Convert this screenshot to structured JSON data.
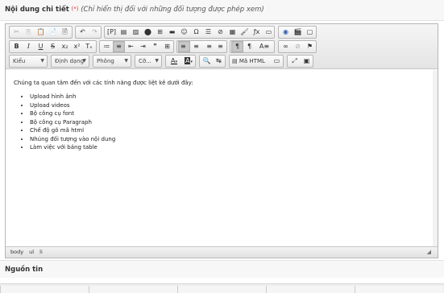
{
  "header": {
    "title": "Nội dung chi tiết",
    "required_mark": "(*)",
    "note": "(Chỉ hiển thị đối với những đối tượng được phép xem)"
  },
  "toolbar": {
    "row1": {
      "clipboard": [
        "cut-icon",
        "copy-icon",
        "paste-icon",
        "paste-text-icon",
        "paste-word-icon"
      ],
      "history": [
        "undo-icon",
        "redo-icon"
      ],
      "insert": [
        "template-icon",
        "page-icon",
        "image-icon",
        "flash-icon",
        "table-icon",
        "horizontal-rule-icon",
        "smiley-icon",
        "special-char-icon",
        "iframe-icon",
        "link-icon",
        "anchor-icon",
        "highlight-icon",
        "formula-icon",
        "preview-icon"
      ],
      "extra": [
        "about-icon",
        "video-icon",
        "maximize-small-icon"
      ]
    },
    "row2": {
      "basic": [
        {
          "label": "B",
          "name": "bold"
        },
        {
          "label": "I",
          "name": "italic"
        },
        {
          "label": "U",
          "name": "underline"
        },
        {
          "label": "S",
          "name": "strike"
        },
        {
          "label": "x₂",
          "name": "subscript"
        },
        {
          "label": "x²",
          "name": "superscript"
        },
        {
          "label": "Tₓ",
          "name": "remove-format"
        }
      ],
      "list_glyphs": [
        "≔",
        "≡",
        "⇤",
        "⇥",
        "❞",
        "⊞"
      ],
      "align_glyphs": [
        "≡",
        "≡",
        "≡",
        "≡"
      ],
      "bidi_glyphs": [
        "¶",
        "¶",
        "A≡"
      ],
      "link_glyphs": [
        "∞",
        "⊘",
        "⚑"
      ]
    },
    "row3": {
      "style": "Kiểu",
      "format": "Định dạng",
      "font": "Phông",
      "size": "Cỡ...",
      "text_color": "A",
      "bg_color": "A",
      "find_glyph": "🔍",
      "replace_glyph": "↹",
      "source_label": "Mã HTML",
      "maximize_glyph": "⤢",
      "show_blocks_glyph": "▣"
    }
  },
  "content": {
    "intro": "Chúng ta quan tâm đến với các tính năng được liệt kê dưới đây:",
    "items": [
      "Upload hình ảnh",
      "Upload videos",
      "Bộ công cụ font",
      "Bộ công cụ Paragraph",
      "Chế độ gõ mã html",
      "Nhúng đối tượng vào nội dung",
      "Làm việc với bảng table"
    ]
  },
  "status": {
    "path": [
      "body",
      "ul",
      "li"
    ],
    "resize_glyph": "◢"
  },
  "source": {
    "title": "Nguồn tin"
  },
  "colors": {
    "required": "#dd3333",
    "toolbar_bg": "#e9e9e9",
    "border": "#b6b6b6"
  }
}
